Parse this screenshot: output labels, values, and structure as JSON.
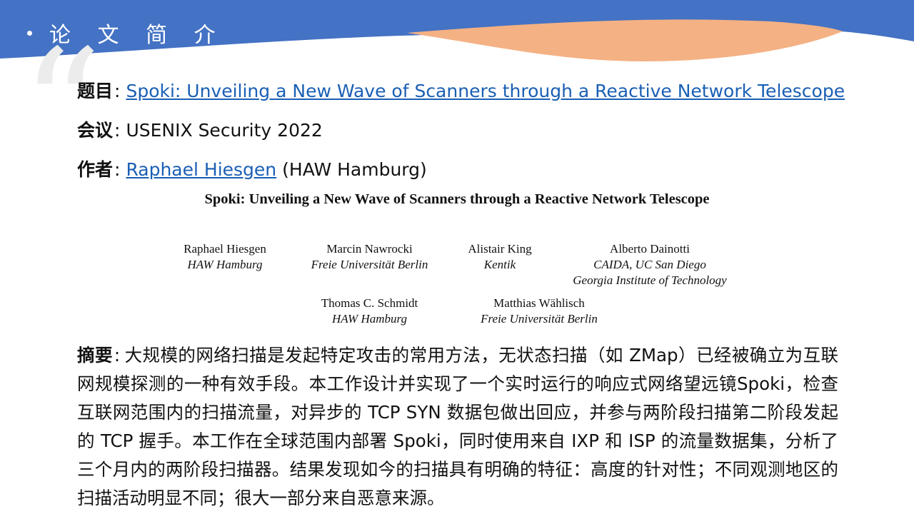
{
  "header": {
    "title": "论 文 简 介"
  },
  "colors": {
    "header_blue": "#4472c4",
    "wave_orange": "#f4b183",
    "link": "#1a5fb4"
  },
  "meta": {
    "title_label": "题目",
    "title_value": "Spoki: Unveiling a New Wave of Scanners through a Reactive Network Telescope",
    "conference_label": "会议",
    "conference_value": "USENIX Security 2022",
    "author_label": "作者",
    "author_link": "Raphael Hiesgen",
    "author_affiliation": "(HAW Hamburg)",
    "separator": ":"
  },
  "paper": {
    "title": "Spoki: Unveiling a New Wave of Scanners through a Reactive Network Telescope",
    "authors": [
      {
        "name": "Raphael Hiesgen",
        "affiliation": "HAW Hamburg"
      },
      {
        "name": "Marcin Nawrocki",
        "affiliation": "Freie Universität Berlin"
      },
      {
        "name": "Alistair King",
        "affiliation": "Kentik"
      },
      {
        "name": "Alberto Dainotti",
        "affiliation": "CAIDA, UC San Diego",
        "affiliation2": "Georgia Institute of Technology"
      },
      {
        "name": "Thomas C. Schmidt",
        "affiliation": "HAW Hamburg"
      },
      {
        "name": "Matthias Wählisch",
        "affiliation": "Freie Universität Berlin"
      }
    ]
  },
  "abstract": {
    "label": "摘要",
    "text": "大规模的网络扫描是发起特定攻击的常用方法，无状态扫描（如 ZMap）已经被确立为互联网规模探测的一种有效手段。本工作设计并实现了一个实时运行的响应式网络望远镜Spoki，检查互联网范围内的扫描流量，对异步的 TCP SYN 数据包做出回应，并参与两阶段扫描第二阶段发起的 TCP 握手。本工作在全球范围内部署 Spoki，同时使用来自 IXP 和 ISP 的流量数据集，分析了三个月内的两阶段扫描器。结果发现如今的扫描具有明确的特征：高度的针对性；不同观测地区的扫描活动明显不同；很大一部分来自恶意来源。"
  }
}
